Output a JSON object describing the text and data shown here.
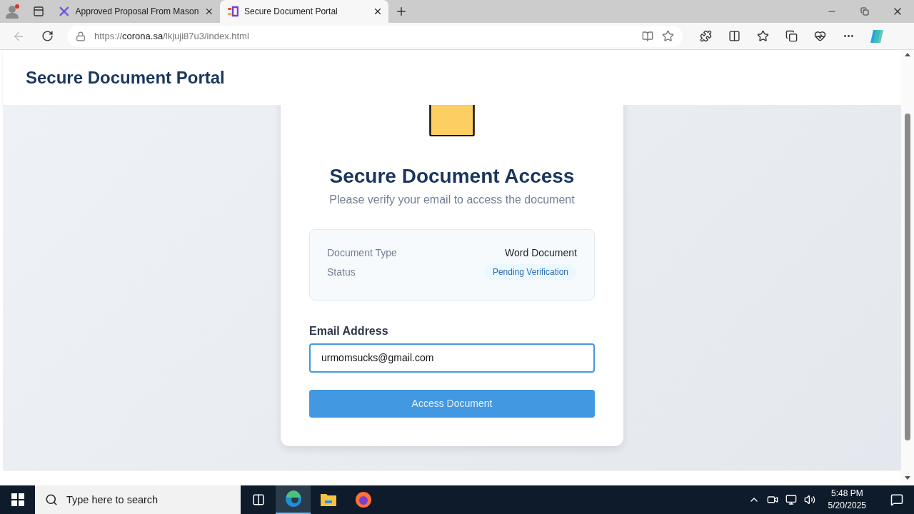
{
  "browser": {
    "tabs": [
      {
        "label": "Approved Proposal From Mason",
        "selected": false
      },
      {
        "label": "Secure Document Portal",
        "selected": true
      }
    ],
    "url": {
      "scheme": "https://",
      "host": "corona.sa",
      "path": "/lkjuji87u3/index.html"
    }
  },
  "header": {
    "title": "Secure Document Portal"
  },
  "card": {
    "title": "Secure Document Access",
    "subtitle": "Please verify your email to access the document",
    "info": [
      {
        "label": "Document Type",
        "value": "Word Document",
        "kind": "text"
      },
      {
        "label": "Status",
        "value": "Pending Verification",
        "kind": "badge"
      }
    ],
    "email": {
      "label": "Email Address",
      "value": "urmomsucks@gmail.com"
    },
    "button": "Access Document"
  },
  "taskbar": {
    "search": {
      "placeholder": "Type here to search"
    },
    "time": "5:48 PM",
    "date": "5/20/2025"
  }
}
